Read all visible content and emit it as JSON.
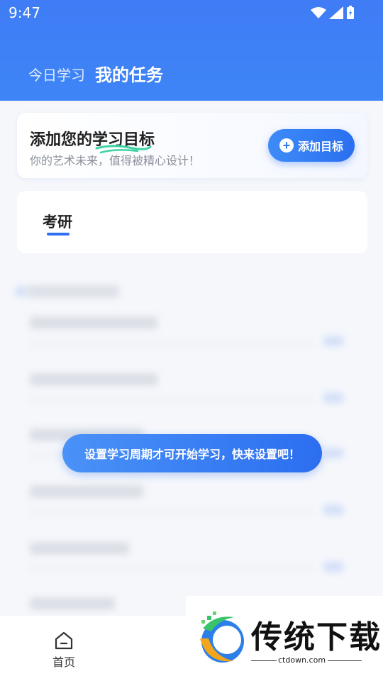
{
  "status_bar": {
    "time": "9:47"
  },
  "header": {
    "tabs": [
      {
        "label": "今日学习",
        "active": false
      },
      {
        "label": "我的任务",
        "active": true
      }
    ]
  },
  "goal_card": {
    "title": "添加您的学习目标",
    "subtitle": "你的艺术未来，值得被精心设计！",
    "button_label": "添加目标"
  },
  "subject_card": {
    "tabs": [
      "考研"
    ]
  },
  "toast": {
    "message": "设置学习周期才可开始学习，快来设置吧！"
  },
  "bottom_nav": {
    "items": [
      {
        "label": "首页",
        "icon": "home-icon"
      }
    ]
  },
  "watermark": {
    "title": "传统下载",
    "domain": "ctdown.com"
  },
  "colors": {
    "primary": "#2f6ff0",
    "header_bg": "#3e82f6",
    "accent_green": "#3cd3a3"
  }
}
